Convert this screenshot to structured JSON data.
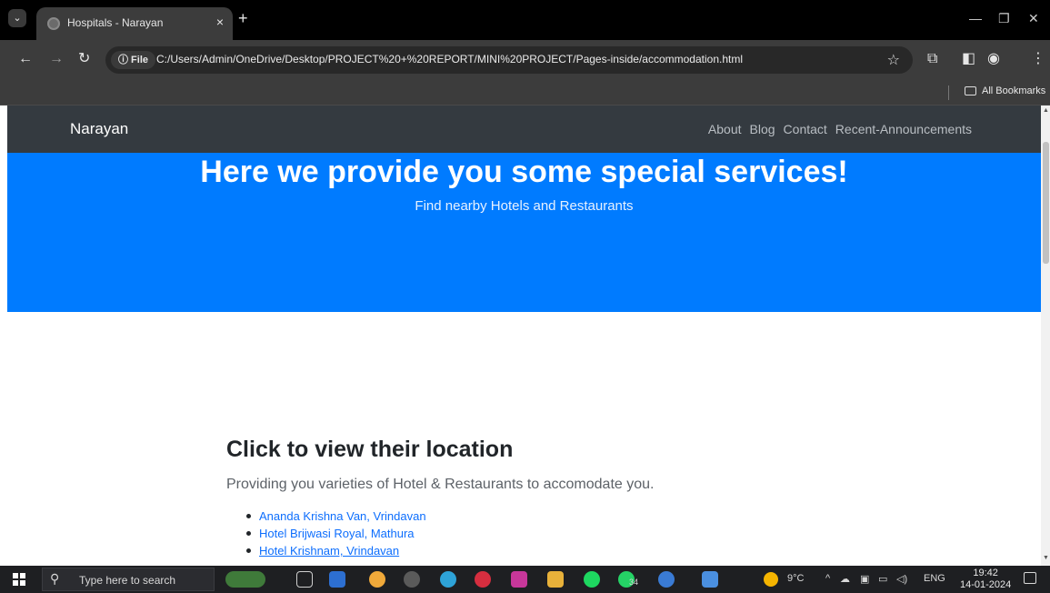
{
  "browser": {
    "tab_title": "Hospitals - Narayan",
    "tab_close": "×",
    "new_tab": "+",
    "info_chip": "ⓘ File",
    "url": "C:/Users/Admin/OneDrive/Desktop/PROJECT%20+%20REPORT/MINI%20PROJECT/Pages-inside/accommodation.html",
    "bookmarks_label": "All Bookmarks"
  },
  "site": {
    "brand": "Narayan",
    "nav": [
      "About",
      "Blog",
      "Contact",
      "Recent-Announcements"
    ]
  },
  "hero": {
    "heading": "Here we provide you some special services!",
    "subheading": "Find nearby Hotels and Restaurants"
  },
  "section": {
    "heading": "Click to view their location",
    "lead": "Providing you varieties of Hotel & Restaurants to accomodate you.",
    "hotels": [
      "Ananda Krishna Van, Vrindavan",
      "Hotel Brijwasi Royal, Mathura",
      "Hotel Krishnam, Vrindavan"
    ]
  },
  "taskbar": {
    "search_placeholder": "Type here to search",
    "weather": "9°C",
    "language": "ENG",
    "time": "19:42",
    "date": "14-01-2024",
    "whatsapp_badge": "34"
  },
  "colors": {
    "navbar": "#343a40",
    "hero": "#007bff",
    "link": "#0d6efd"
  }
}
